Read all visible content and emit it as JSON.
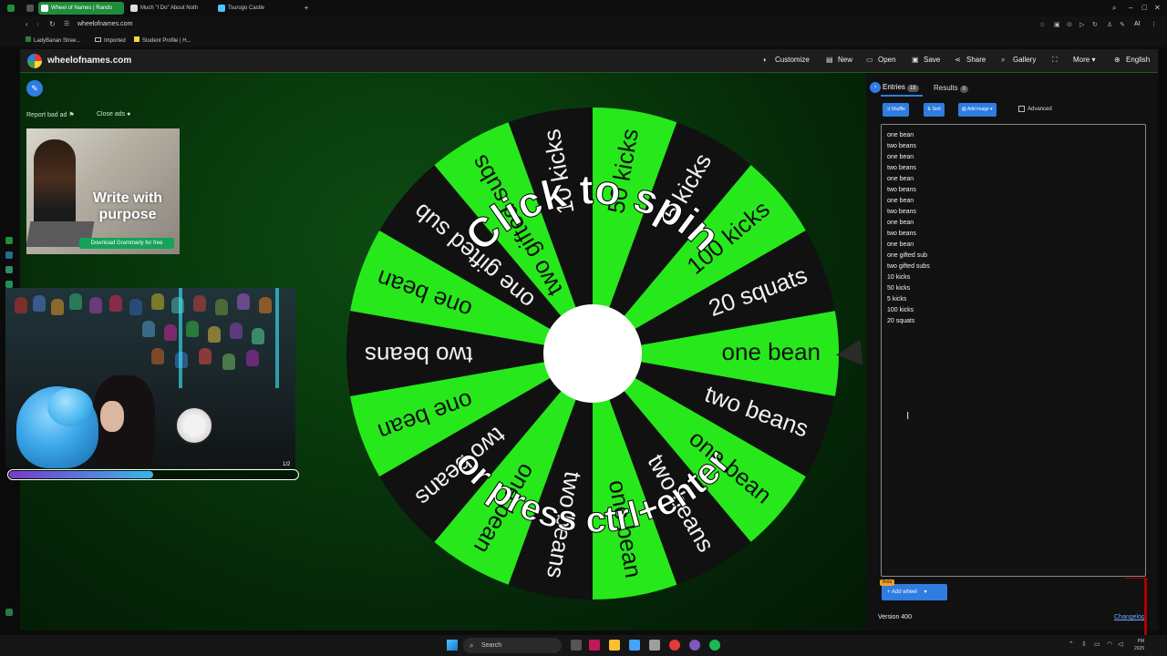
{
  "browser": {
    "tabs": [
      {
        "title": "Wheel of Names | Rando",
        "active": true,
        "favicon_color": "#2ea043"
      },
      {
        "title": "Much \"I Do\" About Noth",
        "active": false,
        "favicon_color": "#ffffff"
      },
      {
        "title": "Tsurugo Castle",
        "active": false,
        "favicon_color": "#4fc3f7"
      }
    ],
    "url": "wheelofnames.com",
    "bookmarks": [
      "LadyBanan Stree...",
      "Imported",
      "Student Profile | H..."
    ]
  },
  "site": {
    "name": "wheelofnames.com",
    "nav": [
      "Customize",
      "New",
      "Open",
      "Save",
      "Share",
      "Gallery",
      "More",
      "English"
    ]
  },
  "sidebar_left": {
    "report_ad": "Report bad ad",
    "close_ads": "Close ads"
  },
  "ad": {
    "headline": "Write with purpose",
    "cta": "Download Grammarly for free"
  },
  "webcam": {
    "slide_count": "1/2",
    "progress": 0.5
  },
  "wheel": {
    "center_top_text": "Click to spin",
    "center_bottom_text": "or press ctrl+enter",
    "accent_green": "#27e81b",
    "dark_segment": "#111111"
  },
  "panel": {
    "entries_label": "Entries",
    "entries_count": "18",
    "results_label": "Results",
    "results_count": "0",
    "buttons": [
      "Shuffle",
      "Sort",
      "Add image"
    ],
    "advanced_label": "Advanced",
    "entries": [
      "one bean",
      "two beans",
      "one bean",
      "two beans",
      "one bean",
      "two beans",
      "one bean",
      "two beans",
      "one bean",
      "two beans",
      "one bean",
      "one gifted sub",
      "two gifted subs",
      "10 kicks",
      "50 kicks",
      "5 kicks",
      "100 kicks",
      "20 squats"
    ],
    "add_wheel": "Add wheel",
    "beta": "Beta",
    "version": "Version 400",
    "changelog": "Changelog"
  },
  "taskbar": {
    "search": "Search",
    "time": "PM",
    "date": "2025"
  }
}
